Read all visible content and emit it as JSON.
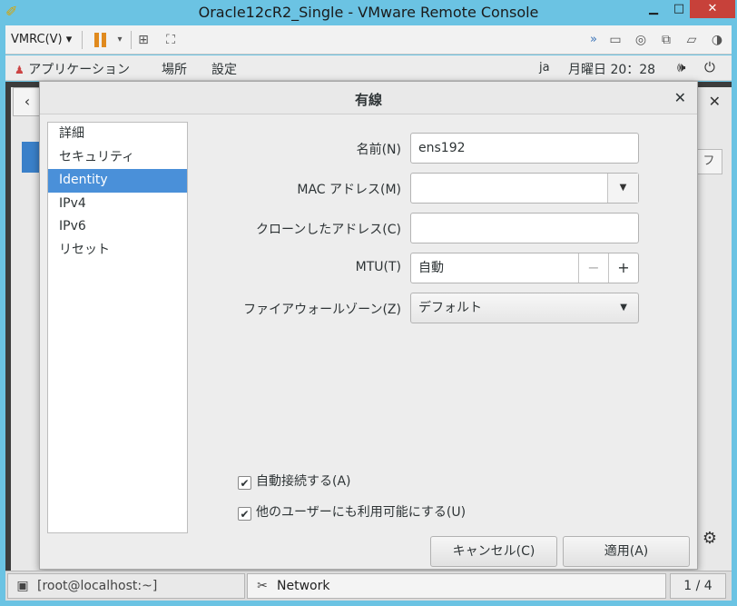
{
  "window": {
    "title": "Oracle12cR2_Single - VMware Remote Console",
    "min": "▁",
    "max": "□",
    "close": "✕"
  },
  "toolbar": {
    "vmrc_label": "VMRC(V) ▾",
    "pause_dropdown": "▾",
    "right_icons": "»"
  },
  "gnome_bar": {
    "apps": "アプリケーション",
    "places": "場所",
    "settings": "設定",
    "lang": "ja",
    "clock": "月曜日 20：28"
  },
  "background_window": {
    "back": "‹",
    "close": "✕",
    "right_tab": "フ"
  },
  "dialog": {
    "title": "有線",
    "close": "✕",
    "sidebar": [
      {
        "label": "詳細",
        "selected": false
      },
      {
        "label": "セキュリティ",
        "selected": false
      },
      {
        "label": "Identity",
        "selected": true
      },
      {
        "label": "IPv4",
        "selected": false
      },
      {
        "label": "IPv6",
        "selected": false
      },
      {
        "label": "リセット",
        "selected": false
      }
    ],
    "fields": {
      "name_label": "名前(N)",
      "name_value": "ens192",
      "mac_label": "MAC アドレス(M)",
      "mac_value": "",
      "clone_label": "クローンしたアドレス(C)",
      "clone_value": "",
      "mtu_label": "MTU(T)",
      "mtu_value": "自動",
      "mtu_minus": "−",
      "mtu_plus": "+",
      "zone_label": "ファイアウォールゾーン(Z)",
      "zone_value": "デフォルト"
    },
    "checks": {
      "auto_connect": "自動接続する(A)",
      "auto_connect_checked": true,
      "all_users": "他のユーザーにも利用可能にする(U)",
      "all_users_checked": true
    },
    "buttons": {
      "cancel": "キャンセル(C)",
      "apply": "適用(A)"
    }
  },
  "taskbar": {
    "terminal": "[root@localhost:~]",
    "network": "Network",
    "pager": "1 / 4"
  },
  "colors": {
    "selection": "#4a90d9",
    "titlebar": "#6bc3e3",
    "close": "#c7413a"
  }
}
